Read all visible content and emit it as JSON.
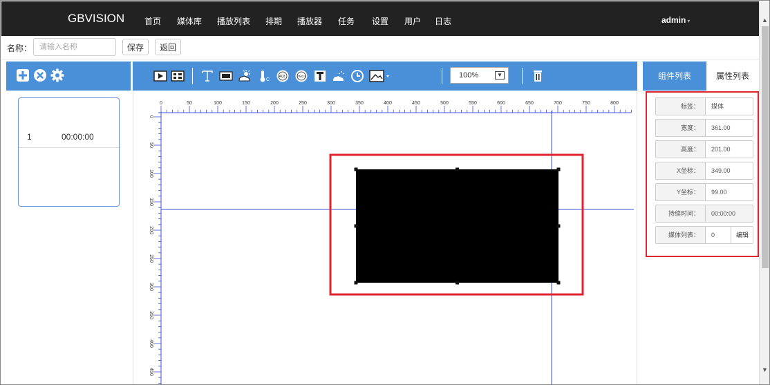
{
  "nav": {
    "brand": "GBVISION",
    "items": [
      "首页",
      "媒体库",
      "播放列表",
      "排期",
      "播放器",
      "任务",
      "设置",
      "用户",
      "日志"
    ],
    "user": "admin"
  },
  "namebar": {
    "label": "名称：",
    "placeholder": "请输入名称",
    "save": "保存",
    "back": "返回"
  },
  "left_toolbar": {
    "icons": [
      "add-icon",
      "close-circle-icon",
      "gear-icon"
    ]
  },
  "slot": {
    "index": "1",
    "time": "00:00:00"
  },
  "toolbar": {
    "icons": [
      "video-icon",
      "image-grid-icon",
      "text-icon",
      "clock-digital-icon",
      "weather-icon",
      "temperature-icon",
      "aqi-icon",
      "pm25-icon",
      "humidity-icon",
      "weather-cloud-icon",
      "clock-icon",
      "image-dropdown-icon",
      "trash-icon"
    ],
    "zoom": "100%"
  },
  "ruler": {
    "h_ticks": [
      "0",
      "50",
      "100",
      "150",
      "200",
      "250",
      "300",
      "350",
      "400",
      "450",
      "500",
      "550",
      "600",
      "650",
      "700",
      "750",
      "800"
    ],
    "v_ticks": [
      "0",
      "50",
      "100",
      "150",
      "200",
      "250",
      "300",
      "350",
      "400",
      "450"
    ]
  },
  "tabs": {
    "components": "组件列表",
    "properties": "属性列表"
  },
  "properties": [
    {
      "key": "标签：",
      "value": "媒体"
    },
    {
      "key": "宽度：",
      "value": "361.00"
    },
    {
      "key": "高度：",
      "value": "201.00"
    },
    {
      "key": "X坐标：",
      "value": "349.00"
    },
    {
      "key": "Y坐标：",
      "value": "99.00"
    },
    {
      "key": "持续时间：",
      "value": "00:00:00"
    },
    {
      "key": "媒体列表：",
      "value": "0",
      "action": "编辑"
    }
  ],
  "colors": {
    "nav_bg": "#222222",
    "accent": "#4a90d9",
    "highlight": "#e0232f",
    "guide": "#3b4fe0"
  }
}
